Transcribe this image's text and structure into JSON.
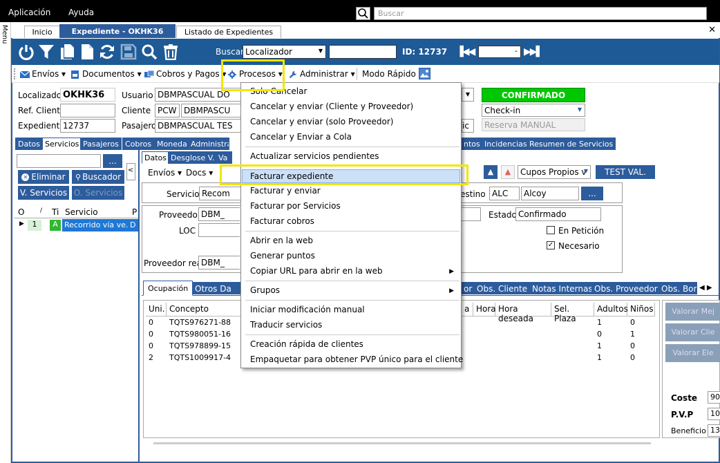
{
  "menubar": {
    "items": [
      "Aplicación",
      "Ayuda"
    ],
    "search_placeholder": "Buscar"
  },
  "sidebar": {
    "label": "Menu"
  },
  "tabs": [
    {
      "label": "Inicio"
    },
    {
      "label": "Expediente  - OKHK36"
    },
    {
      "label": "Listado de Expedientes"
    }
  ],
  "toolbar": {
    "buscar_label": "Buscar",
    "buscar_select": "Localizador",
    "id_label": "ID: 12737",
    "nav_value": "-"
  },
  "actions": {
    "envios": "Envíos",
    "documentos": "Documentos",
    "cobros": "Cobros y Pagos",
    "procesos": "Procesos",
    "administrar": "Administrar",
    "modo_rapido": "Modo Rápido"
  },
  "header": {
    "localizador_label": "Localizador",
    "localizador_value": "OKHK36",
    "ref_cliente_label": "Ref. Cliente",
    "ref_cliente_value": "",
    "expediente_label": "Expediente",
    "expediente_value": "12737",
    "usuario_label": "Usuario",
    "usuario_value": "DBMPASCUAL DO",
    "cliente_label": "Cliente",
    "cliente_code": "PCW",
    "cliente_value": "DBMPASCU",
    "pasajero_label": "Pasajero",
    "pasajero_value": "DBMPASCUAL TES",
    "status": "CONFIRMADO",
    "checkin": "Check-in",
    "reserva": "Reserva MANUAL",
    "partial_label": "ic"
  },
  "main_tabs": [
    "Datos",
    "Servicios",
    "Pasajeros",
    "Cobros",
    "Moneda",
    "Administra",
    "ntos",
    "Incidencias",
    "Resumen de Servicios"
  ],
  "left": {
    "search_btn": "...",
    "eliminar": "Eliminar",
    "buscador": "Buscador",
    "vservicios": "V. Servicios",
    "oservicios": "O. Servicios",
    "cols": [
      "O",
      "/",
      "Ti",
      "Servicio",
      "P"
    ],
    "row": {
      "num": "1",
      "type": "A",
      "servicio": "Recorrido vía ve...",
      "p": "D"
    }
  },
  "detail_tabs": [
    "Datos",
    "Desglose V.",
    "Va"
  ],
  "detail": {
    "envios": "Envíos",
    "docs": "Docs",
    "cupos": "Cupos Propios v",
    "test_val": "TEST VAL.",
    "servicio_label": "Servicio",
    "servicio_value": "Recom",
    "destino_label": "estino",
    "destino_code": "ALC",
    "destino_value": "Alcoy",
    "destino_btn": "...",
    "proveedor_label": "Proveedor",
    "proveedor_value": "DBM_",
    "loc_label": "LOC",
    "estado_label": "Estado",
    "estado_value": "Confirmado",
    "en_peticion": "En Petición",
    "necesario": "Necesario",
    "proveedor_real_label": "Proveedor real",
    "proveedor_real_value": "DBM_"
  },
  "bottom_tabs": [
    "Ocupación",
    "Otros Da",
    "or",
    "Obs. Cliente",
    "Notas Internas",
    "Obs. Proveedor",
    "Obs. Bon"
  ],
  "grid": {
    "headers": [
      "Uni.",
      "Concepto",
      "a",
      "Hora",
      "Hora deseada",
      "Sel. Plaza",
      "Adultos",
      "Niños"
    ],
    "rows": [
      {
        "uni": "0",
        "concepto": "TQTS976271-88",
        "adultos": "1",
        "ninos": "0"
      },
      {
        "uni": "0",
        "concepto": "TQTS980051-16",
        "adultos": "0",
        "ninos": "1"
      },
      {
        "uni": "0",
        "concepto": "TQTS978899-15",
        "adultos": "1",
        "ninos": "0"
      },
      {
        "uni": "2",
        "concepto": "TQTS1009917-4",
        "adultos": "1",
        "ninos": "0"
      }
    ]
  },
  "right_panel": {
    "buttons": [
      "Valorar Mej",
      "Valorar Clie",
      "Valorar Ele"
    ],
    "coste_label": "Coste",
    "coste_value": "90",
    "pvp_label": "P.V.P",
    "pvp_value": "10",
    "beneficio_label": "Beneficio",
    "beneficio_value": "13"
  },
  "procesos_menu": {
    "items": [
      "Solo Cancelar",
      "Cancelar y enviar (Cliente y Proveedor)",
      "Cancelar y enviar (solo Proveedor)",
      "Cancelar y Enviar a Cola",
      "Actualizar servicios pendientes",
      "Facturar expediente",
      "Facturar y enviar",
      "Facturar por Servicios",
      "Facturar cobros",
      "Abrir en la web",
      "Generar puntos",
      "Copiar URL para abrir en la web",
      "Grupos",
      "Iniciar modificación manual",
      "Traducir servicios",
      "Creación rápida de clientes",
      "Empaquetar para obtener PVP único para el cliente"
    ]
  },
  "colors": {
    "toolbar_blue": "#1e5a96",
    "tab_blue": "#2d5c9c",
    "status_green": "#00c800",
    "highlight_yellow": "#f2e600"
  }
}
